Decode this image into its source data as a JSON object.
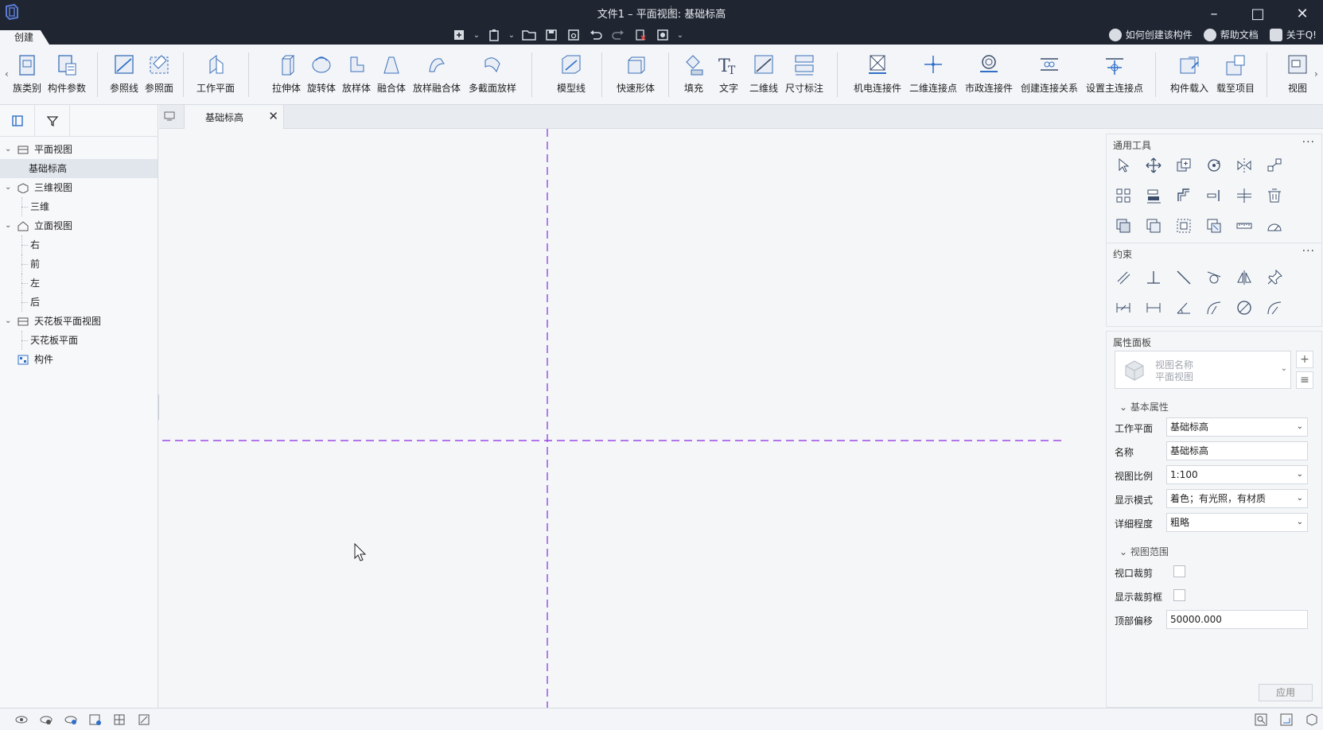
{
  "window": {
    "title": "文件1 – 平面视图: 基础标高",
    "title_extra": "⁝",
    "minimize": "–",
    "maximize": "□",
    "close": "✕"
  },
  "tabs": {
    "create": "创建"
  },
  "help_links": [
    "如何创建该构件",
    "帮助文档",
    "关于Q!"
  ],
  "ribbon": {
    "items": [
      {
        "label": "族类别",
        "icon": "family-category-icon"
      },
      {
        "label": "构件参数",
        "icon": "component-params-icon"
      },
      {
        "label": "参照线",
        "icon": "reference-line-icon"
      },
      {
        "label": "参照面",
        "icon": "reference-plane-icon"
      },
      {
        "label": "工作平面",
        "icon": "work-plane-icon"
      },
      {
        "label": "拉伸体",
        "icon": "extrusion-icon"
      },
      {
        "label": "旋转体",
        "icon": "revolve-icon"
      },
      {
        "label": "放样体",
        "icon": "sweep-icon"
      },
      {
        "label": "融合体",
        "icon": "blend-icon"
      },
      {
        "label": "放样融合体",
        "icon": "swept-blend-icon"
      },
      {
        "label": "多截面放样",
        "icon": "multi-section-sweep-icon"
      },
      {
        "label": "模型线",
        "icon": "model-line-icon"
      },
      {
        "label": "快速形体",
        "icon": "quick-shape-icon"
      },
      {
        "label": "填充",
        "icon": "fill-icon"
      },
      {
        "label": "文字",
        "icon": "text-icon"
      },
      {
        "label": "二维线",
        "icon": "2d-line-icon"
      },
      {
        "label": "尺寸标注",
        "icon": "dimension-icon"
      },
      {
        "label": "机电连接件",
        "icon": "mep-connector-icon"
      },
      {
        "label": "二维连接点",
        "icon": "2d-connect-point-icon"
      },
      {
        "label": "市政连接件",
        "icon": "civil-connector-icon"
      },
      {
        "label": "创建连接关系",
        "icon": "create-connection-icon"
      },
      {
        "label": "设置主连接点",
        "icon": "set-main-connector-icon"
      },
      {
        "label": "构件载入",
        "icon": "load-component-icon"
      },
      {
        "label": "载至项目",
        "icon": "load-to-project-icon"
      },
      {
        "label": "视图",
        "icon": "view-icon"
      }
    ]
  },
  "tree": [
    {
      "label": "平面视图",
      "type": "group",
      "expanded": true,
      "icon": "plan-view-icon"
    },
    {
      "label": "基础标高",
      "type": "child",
      "selected": true
    },
    {
      "label": "三维视图",
      "type": "group",
      "expanded": true,
      "icon": "3d-view-icon"
    },
    {
      "label": "三维",
      "type": "child"
    },
    {
      "label": "立面视图",
      "type": "group",
      "expanded": true,
      "icon": "elevation-view-icon"
    },
    {
      "label": "右",
      "type": "child"
    },
    {
      "label": "前",
      "type": "child"
    },
    {
      "label": "左",
      "type": "child"
    },
    {
      "label": "后",
      "type": "child"
    },
    {
      "label": "天花板平面视图",
      "type": "group",
      "expanded": true,
      "icon": "ceiling-plan-icon"
    },
    {
      "label": "天花板平面",
      "type": "child"
    },
    {
      "label": "构件",
      "type": "leaf",
      "icon": "component-icon"
    }
  ],
  "doc_tab": {
    "label": "基础标高",
    "close": "✕"
  },
  "right_panel": {
    "general_tools": {
      "title": "通用工具",
      "more": "···"
    },
    "constraints": {
      "title": "约束",
      "more": "···"
    },
    "properties": {
      "title": "属性面板",
      "type_name_1": "视图名称",
      "type_name_2": "平面视图",
      "basic_section": "基本属性",
      "view_range_section": "视图范围",
      "rows": {
        "work_plane": {
          "label": "工作平面",
          "value": "基础标高"
        },
        "name": {
          "label": "名称",
          "value": "基础标高"
        },
        "scale": {
          "label": "视图比例",
          "value": "1:100"
        },
        "display_mode": {
          "label": "显示模式",
          "value": "着色；有光照，有材质"
        },
        "detail_level": {
          "label": "详细程度",
          "value": "粗略"
        },
        "viewport_crop": {
          "label": "视口裁剪",
          "checked": false
        },
        "show_crop_box": {
          "label": "显示裁剪框",
          "checked": false
        },
        "top_offset": {
          "label": "顶部偏移",
          "value": "50000.000"
        }
      },
      "apply": "应用"
    }
  },
  "colors": {
    "titlebar": "#1f2632",
    "accent_blue": "#2f6fc7",
    "reference_line": "#8a2be2"
  }
}
